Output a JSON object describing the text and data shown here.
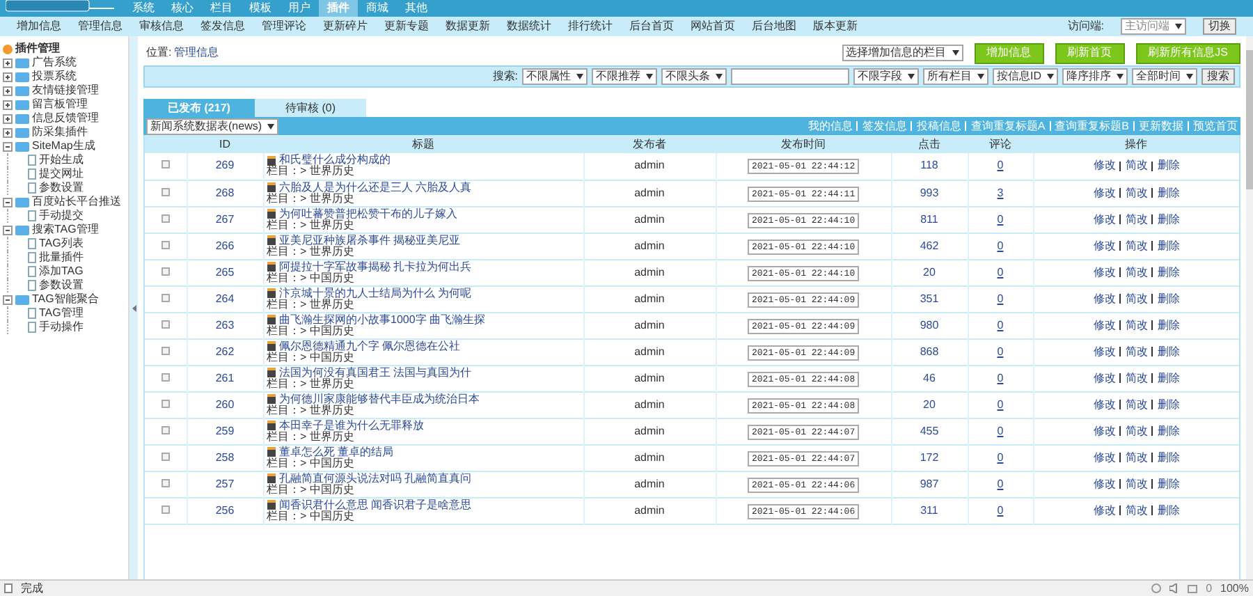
{
  "top_nav": [
    {
      "label": "系统",
      "selected": false
    },
    {
      "label": "核心",
      "selected": false
    },
    {
      "label": "栏目",
      "selected": false
    },
    {
      "label": "模板",
      "selected": false
    },
    {
      "label": "用户",
      "selected": false
    },
    {
      "label": "插件",
      "selected": true
    },
    {
      "label": "商城",
      "selected": false
    },
    {
      "label": "其他",
      "selected": false
    }
  ],
  "sub_nav": [
    "增加信息",
    "管理信息",
    "审核信息",
    "签发信息",
    "管理评论",
    "更新碎片",
    "更新专题",
    "数据更新",
    "数据统计",
    "排行统计",
    "后台首页",
    "网站首页",
    "后台地图",
    "版本更新"
  ],
  "access": {
    "label": "访问端:",
    "value": "主访问端",
    "button": "切换"
  },
  "sidebar": {
    "title": "插件管理",
    "items": [
      {
        "label": "广告系统",
        "expanded": false
      },
      {
        "label": "投票系统",
        "expanded": false
      },
      {
        "label": "友情链接管理",
        "expanded": false
      },
      {
        "label": "留言板管理",
        "expanded": false
      },
      {
        "label": "信息反馈管理",
        "expanded": false
      },
      {
        "label": "防采集插件",
        "expanded": false
      },
      {
        "label": "SiteMap生成",
        "expanded": true,
        "children": [
          {
            "label": "开始生成"
          },
          {
            "label": "提交网址"
          },
          {
            "label": "参数设置"
          }
        ]
      },
      {
        "label": "百度站长平台推送",
        "expanded": true,
        "children": [
          {
            "label": "手动提交"
          }
        ]
      },
      {
        "label": "搜索TAG管理",
        "expanded": true,
        "children": [
          {
            "label": "TAG列表"
          },
          {
            "label": "批量插件"
          },
          {
            "label": "添加TAG"
          },
          {
            "label": "参数设置"
          }
        ]
      },
      {
        "label": "TAG智能聚合",
        "expanded": true,
        "children": [
          {
            "label": "TAG管理"
          },
          {
            "label": "手动操作"
          }
        ]
      }
    ]
  },
  "location": {
    "label": "位置:",
    "value": "管理信息"
  },
  "actions": {
    "select": "选择增加信息的栏目",
    "buttons": [
      "增加信息",
      "刷新首页",
      "刷新所有信息JS"
    ]
  },
  "search": {
    "label": "搜索:",
    "filters_left": [
      "不限属性",
      "不限推荐",
      "不限头条"
    ],
    "filters_right": [
      "不限字段",
      "所有栏目",
      "按信息ID",
      "降序排序",
      "全部时间"
    ],
    "button": "搜索"
  },
  "tabs": [
    {
      "label": "已发布 (217)",
      "selected": true
    },
    {
      "label": "待审核 (0)",
      "selected": false
    }
  ],
  "table_select": "新闻系统数据表(news)",
  "table_links": [
    "我的信息",
    "签发信息",
    "投稿信息",
    "查询重复标题A",
    "查询重复标题B",
    "更新数据",
    "预览首页"
  ],
  "columns": [
    "ID",
    "标题",
    "发布者",
    "发布时间",
    "点击",
    "评论",
    "操作"
  ],
  "rows": [
    {
      "id": "269",
      "title": "和氏璧什么成分构成的",
      "category": "栏目：> 世界历史",
      "author": "admin",
      "time": "2021-05-01 22:44:12",
      "clicks": "118",
      "comments": "0",
      "checked": false,
      "actions": [
        "修改",
        "简改",
        "删除"
      ]
    },
    {
      "id": "268",
      "title": "六胎及人是为什么还是三人 六胎及人真",
      "category": "栏目：> 世界历史",
      "author": "admin",
      "time": "2021-05-01 22:44:11",
      "clicks": "993",
      "comments": "3",
      "checked": false,
      "actions": [
        "修改",
        "简改",
        "删除"
      ]
    },
    {
      "id": "267",
      "title": "为何吐蕃赞普把松赞干布的儿子嫁入",
      "category": "栏目：> 世界历史",
      "author": "admin",
      "time": "2021-05-01 22:44:10",
      "clicks": "811",
      "comments": "0",
      "checked": false,
      "actions": [
        "修改",
        "简改",
        "删除"
      ]
    },
    {
      "id": "266",
      "title": "亚美尼亚种族屠杀事件 揭秘亚美尼亚",
      "category": "栏目：> 世界历史",
      "author": "admin",
      "time": "2021-05-01 22:44:10",
      "clicks": "462",
      "comments": "0",
      "checked": false,
      "actions": [
        "修改",
        "简改",
        "删除"
      ]
    },
    {
      "id": "265",
      "title": "阿提拉十字军故事揭秘 扎卡拉为何出兵",
      "category": "栏目：> 中国历史",
      "author": "admin",
      "time": "2021-05-01 22:44:10",
      "clicks": "20",
      "comments": "0",
      "checked": false,
      "actions": [
        "修改",
        "简改",
        "删除"
      ]
    },
    {
      "id": "264",
      "title": "汴京城十景的九人士结局为什么 为何呢",
      "category": "栏目：> 世界历史",
      "author": "admin",
      "time": "2021-05-01 22:44:09",
      "clicks": "351",
      "comments": "0",
      "checked": false,
      "actions": [
        "修改",
        "简改",
        "删除"
      ]
    },
    {
      "id": "263",
      "title": "曲飞瀚生探网的小故事1000字 曲飞瀚生探",
      "category": "栏目：> 中国历史",
      "author": "admin",
      "time": "2021-05-01 22:44:09",
      "clicks": "980",
      "comments": "0",
      "checked": false,
      "actions": [
        "修改",
        "简改",
        "删除"
      ]
    },
    {
      "id": "262",
      "title": "佩尔恩德精通九个字 佩尔恩德在公社",
      "category": "栏目：> 中国历史",
      "author": "admin",
      "time": "2021-05-01 22:44:09",
      "clicks": "868",
      "comments": "0",
      "checked": false,
      "actions": [
        "修改",
        "简改",
        "删除"
      ]
    },
    {
      "id": "261",
      "title": "法国为何没有真国君王 法国与真国为什",
      "category": "栏目：> 世界历史",
      "author": "admin",
      "time": "2021-05-01 22:44:08",
      "clicks": "46",
      "comments": "0",
      "checked": false,
      "actions": [
        "修改",
        "简改",
        "删除"
      ]
    },
    {
      "id": "260",
      "title": "为何德川家康能够替代丰臣成为统治日本",
      "category": "栏目：> 世界历史",
      "author": "admin",
      "time": "2021-05-01 22:44:08",
      "clicks": "20",
      "comments": "0",
      "checked": false,
      "actions": [
        "修改",
        "简改",
        "删除"
      ]
    },
    {
      "id": "259",
      "title": "本田幸子是谁为什么无罪释放",
      "category": "栏目：> 世界历史",
      "author": "admin",
      "time": "2021-05-01 22:44:07",
      "clicks": "455",
      "comments": "0",
      "checked": false,
      "actions": [
        "修改",
        "简改",
        "删除"
      ]
    },
    {
      "id": "258",
      "title": "董卓怎么死 董卓的结局",
      "category": "栏目：> 中国历史",
      "author": "admin",
      "time": "2021-05-01 22:44:07",
      "clicks": "172",
      "comments": "0",
      "checked": false,
      "actions": [
        "修改",
        "简改",
        "删除"
      ]
    },
    {
      "id": "257",
      "title": "孔融简直何源头说法对吗 孔融简直真问",
      "category": "栏目：> 中国历史",
      "author": "admin",
      "time": "2021-05-01 22:44:06",
      "clicks": "987",
      "comments": "0",
      "checked": false,
      "actions": [
        "修改",
        "简改",
        "删除"
      ]
    },
    {
      "id": "256",
      "title": "闻香识君什么意思 闻香识君子是啥意思",
      "category": "栏目：> 中国历史",
      "author": "admin",
      "time": "2021-05-01 22:44:06",
      "clicks": "311",
      "comments": "0",
      "checked": false,
      "actions": [
        "修改",
        "简改",
        "删除"
      ]
    }
  ],
  "status_bar": {
    "text": "完成",
    "count": "0",
    "zoom": "100%"
  }
}
